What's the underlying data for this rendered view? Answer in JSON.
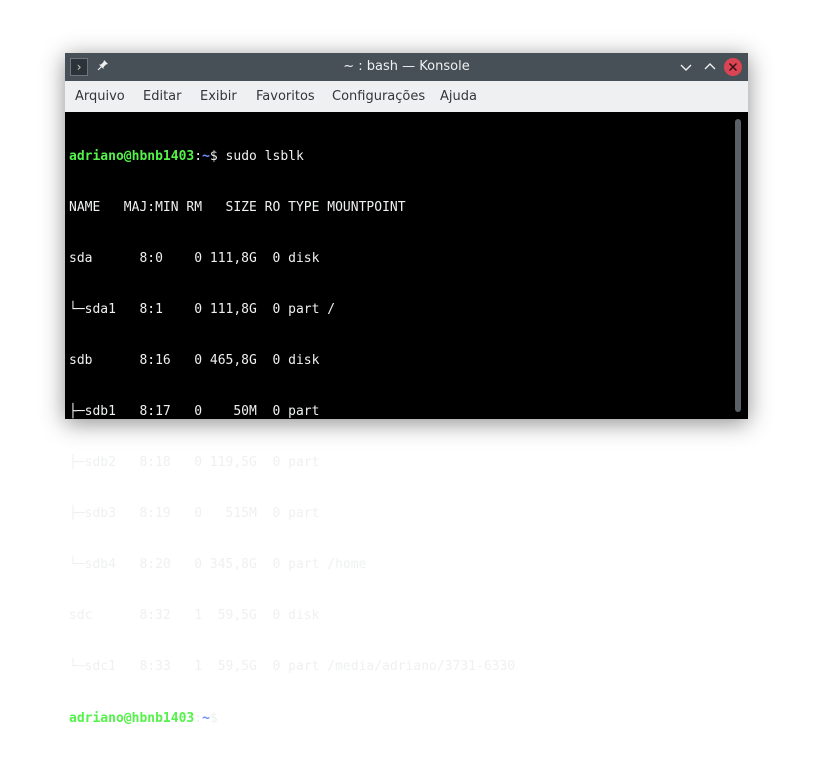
{
  "window": {
    "title": "~ : bash — Konsole"
  },
  "menu": [
    "Arquivo",
    "Editar",
    "Exibir",
    "Favoritos",
    "Configurações",
    "Ajuda"
  ],
  "terminal": {
    "prompt_user": "adriano@hbnb1403",
    "prompt_sep": ":",
    "prompt_path": "~",
    "prompt_symbol": "$",
    "command": "sudo lsblk",
    "output": [
      "NAME   MAJ:MIN RM   SIZE RO TYPE MOUNTPOINT",
      "sda      8:0    0 111,8G  0 disk",
      "└─sda1   8:1    0 111,8G  0 part /",
      "sdb      8:16   0 465,8G  0 disk",
      "├─sdb1   8:17   0    50M  0 part",
      "├─sdb2   8:18   0 119,5G  0 part",
      "├─sdb3   8:19   0   515M  0 part",
      "└─sdb4   8:20   0 345,8G  0 part /home",
      "sdc      8:32   1  59,5G  0 disk",
      "└─sdc1   8:33   1  59,5G  0 part /media/adriano/3731-6330"
    ]
  },
  "colors": {
    "titlebar": "#475057",
    "menubar": "#eff0f1",
    "terminal_bg": "#000000",
    "prompt_user": "#54f24a",
    "prompt_path": "#6f8fff",
    "close_button": "#da4453"
  },
  "icons": {
    "app": "konsole-icon",
    "pin": "pin-icon",
    "minimize": "chevron-down-icon",
    "maximize": "chevron-up-icon",
    "close": "close-icon"
  }
}
